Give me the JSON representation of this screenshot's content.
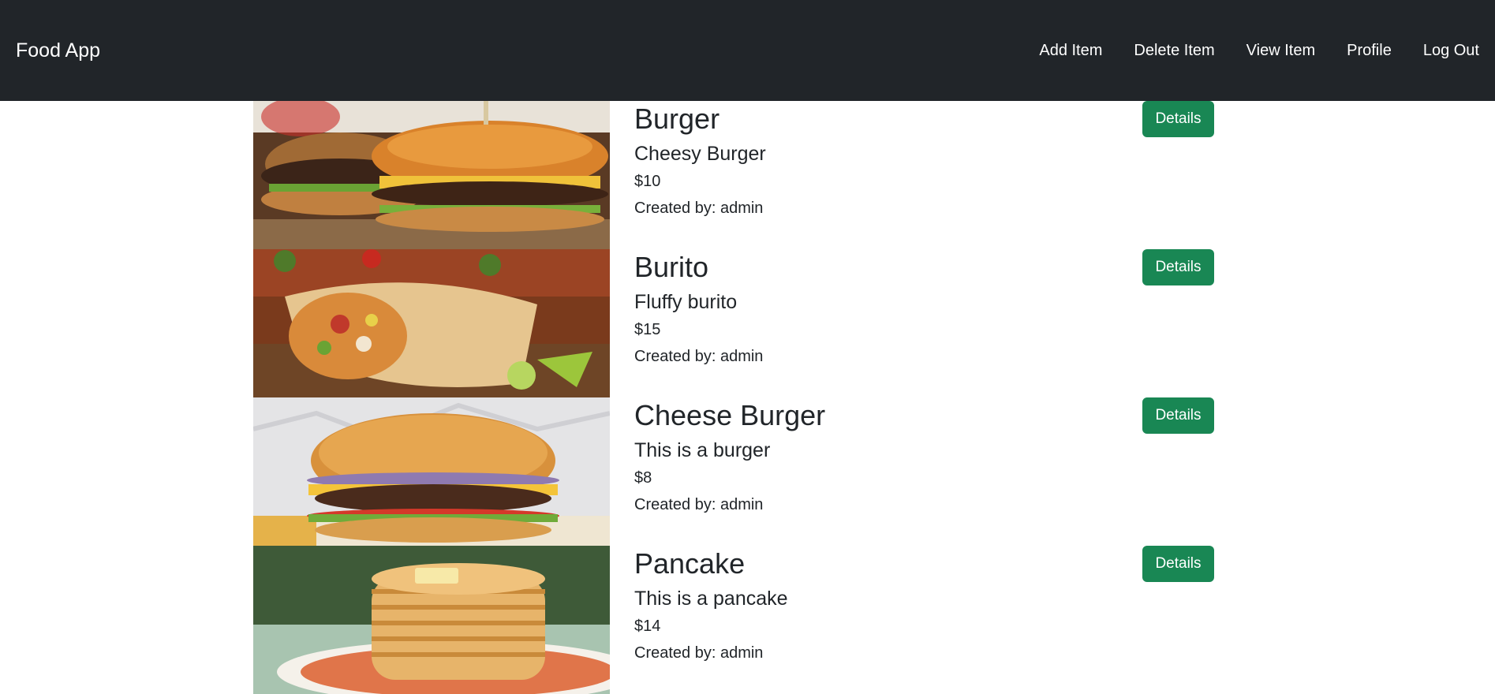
{
  "navbar": {
    "brand": "Food App",
    "links": [
      "Add Item",
      "Delete Item",
      "View Item",
      "Profile",
      "Log Out"
    ]
  },
  "items": [
    {
      "title": "Burger",
      "description": "Cheesy Burger",
      "price": "$10",
      "created_by": "Created by: admin",
      "button": "Details",
      "image": "burger-photo"
    },
    {
      "title": "Burito",
      "description": "Fluffy burito",
      "price": "$15",
      "created_by": "Created by: admin",
      "button": "Details",
      "image": "burrito-photo"
    },
    {
      "title": "Cheese Burger",
      "description": "This is a burger",
      "price": "$8",
      "created_by": "Created by: admin",
      "button": "Details",
      "image": "cheeseburger-photo"
    },
    {
      "title": "Pancake",
      "description": "This is a pancake",
      "price": "$14",
      "created_by": "Created by: admin",
      "button": "Details",
      "image": "pancake-photo"
    }
  ],
  "colors": {
    "navbar_bg": "#212529",
    "button_bg": "#198754",
    "text": "#212529"
  }
}
